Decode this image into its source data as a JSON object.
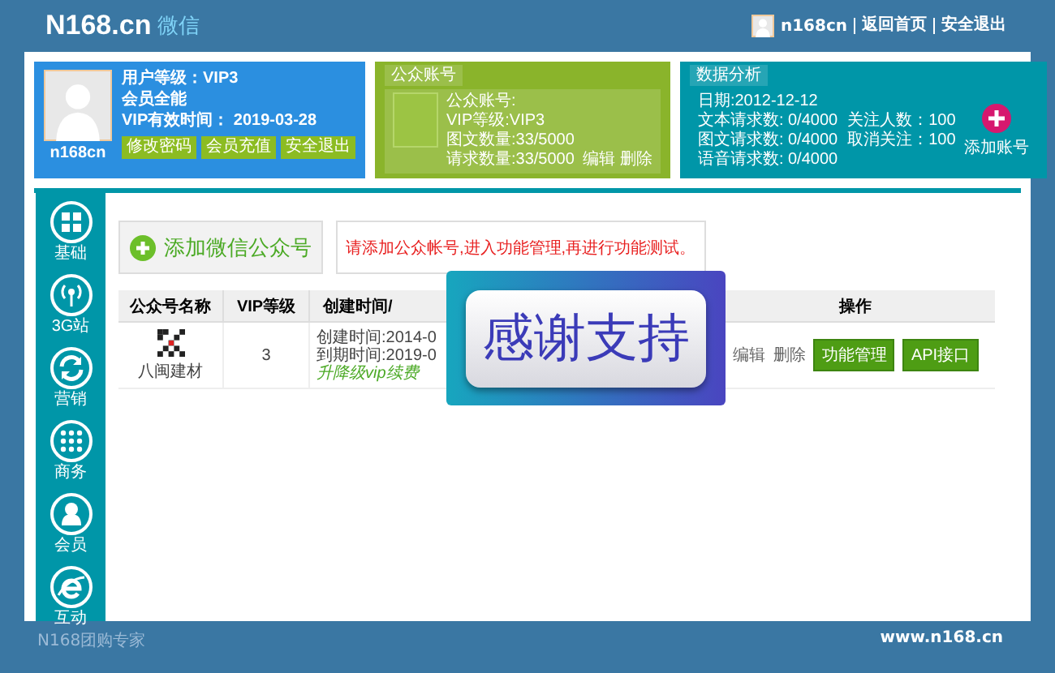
{
  "header": {
    "logo": "N168.cn",
    "logo_sub": "微信",
    "username": "n168cn",
    "links": [
      "返回首页",
      "安全退出"
    ]
  },
  "user_card": {
    "name": "n168cn",
    "lines": [
      "用户等级：VIP3",
      "会员全能",
      "VIP有效时间： 2019-03-28"
    ],
    "buttons": [
      "修改密码",
      "会员充值",
      "安全退出"
    ]
  },
  "account_card": {
    "title": "公众账号",
    "lines": [
      "公众账号:",
      "VIP等级:VIP3",
      "图文数量:33/5000",
      "请求数量:33/5000"
    ],
    "actions": [
      "编辑",
      "删除"
    ]
  },
  "stats_card": {
    "title": "数据分析",
    "date": "日期:2012-12-12",
    "rows": [
      {
        "left": "文本请求数: 0/4000",
        "right": "关注人数：100"
      },
      {
        "left": "图文请求数: 0/4000",
        "right": "取消关注：100"
      },
      {
        "left": "语音请求数: 0/4000"
      }
    ],
    "add_label": "添加账号"
  },
  "sidebar": {
    "items": [
      {
        "label": "基础",
        "kind": "grid"
      },
      {
        "label": "3G站",
        "kind": "signal"
      },
      {
        "label": "营销",
        "kind": "refresh"
      },
      {
        "label": "商务",
        "kind": "dots"
      },
      {
        "label": "会员",
        "kind": "person"
      },
      {
        "label": "互动",
        "kind": "browser"
      }
    ]
  },
  "add_button": "添加微信公众号",
  "notice": "请添加公众帐号,进入功能管理,再进行功能测试。",
  "table": {
    "columns": [
      "公众号名称",
      "VIP等级",
      "创建时间/",
      "操作"
    ],
    "rows": [
      {
        "name": "八闽建材",
        "vip": "3",
        "times": [
          "创建时间:2014-0",
          "到期时间:2019-0"
        ],
        "upgrade": "升降级vip续费",
        "actions": [
          "编辑",
          "删除"
        ],
        "buttons": [
          "功能管理",
          "API接口"
        ]
      }
    ]
  },
  "overlay": {
    "text": "感谢支持"
  },
  "footer": {
    "left": "N168团购专家",
    "right": "www.n168.cn"
  }
}
